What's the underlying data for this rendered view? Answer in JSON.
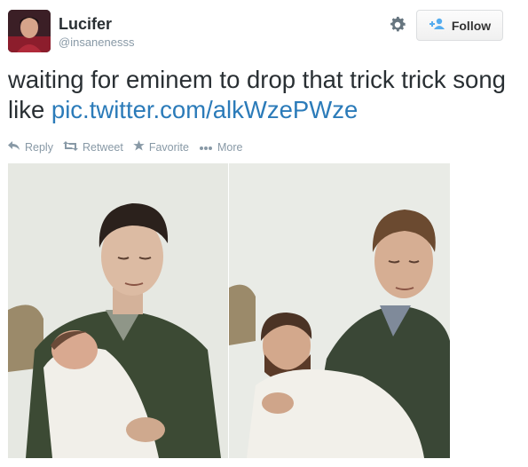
{
  "user": {
    "name": "Lucifer",
    "handle": "@insanenesss",
    "avatar_icon": "profile-avatar"
  },
  "header": {
    "settings_icon": "gear-icon",
    "follow_icon": "follow-person-plus-icon",
    "follow_label": "Follow"
  },
  "tweet": {
    "text": "waiting for eminem to drop that trick trick song like ",
    "link": "pic.twitter.com/alkWzePWze"
  },
  "actions": [
    {
      "label": "Reply",
      "icon": "reply-icon"
    },
    {
      "label": "Retweet",
      "icon": "retweet-icon"
    },
    {
      "label": "Favorite",
      "icon": "star-icon"
    },
    {
      "label": "More",
      "icon": "more-dots-icon"
    }
  ],
  "colors": {
    "link": "#2b7bb9",
    "muted": "#8899a6",
    "text": "#292f33"
  }
}
